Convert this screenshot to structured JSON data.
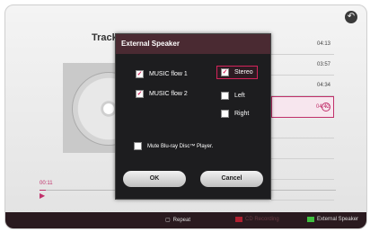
{
  "header": {
    "title": "Track"
  },
  "tracks": [
    {
      "time": "04:13"
    },
    {
      "time": "03:57"
    },
    {
      "time": "04:34"
    },
    {
      "time": "04:42"
    },
    {
      "time": ""
    },
    {
      "time": ""
    },
    {
      "time": ""
    },
    {
      "time": ""
    }
  ],
  "player": {
    "elapsed": "00:11",
    "progress_fraction": 0.02
  },
  "dialog": {
    "title": "External Speaker",
    "flows": [
      {
        "label": "MUSIC flow 1",
        "checked": true
      },
      {
        "label": "MUSIC flow 2",
        "checked": true
      }
    ],
    "channels": [
      {
        "label": "Stereo",
        "checked": true,
        "selected": true
      },
      {
        "label": "Left",
        "checked": false,
        "selected": false
      },
      {
        "label": "Right",
        "checked": false,
        "selected": false
      }
    ],
    "mute_label": "Mute Blu-ray Disc™ Player.",
    "ok_label": "OK",
    "cancel_label": "Cancel"
  },
  "bottom_bar": {
    "repeat_label": "Repeat",
    "cd_recording_label": "CD Recording",
    "external_speaker_label": "External Speaker"
  },
  "colors": {
    "accent": "#c0306a",
    "green_key": "#3fbf3f",
    "red_key": "#b02030"
  }
}
